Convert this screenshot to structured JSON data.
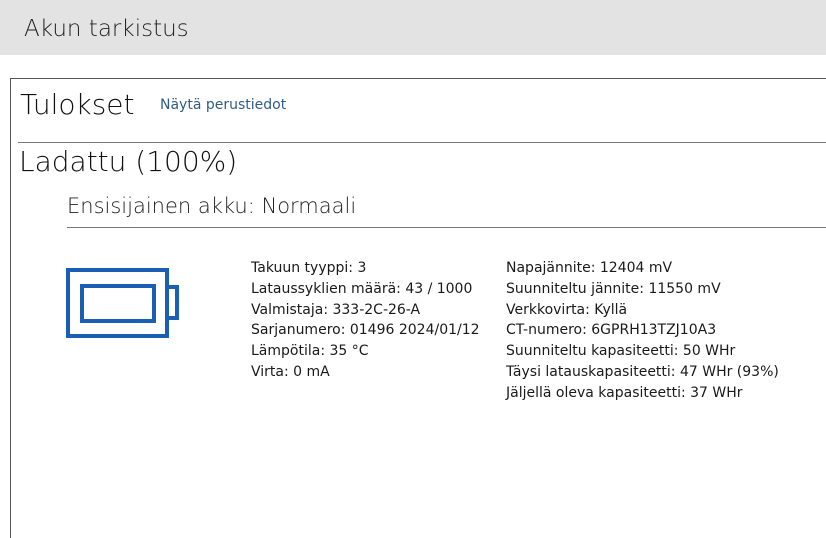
{
  "window": {
    "title": "Akun tarkistus"
  },
  "results": {
    "title": "Tulokset",
    "basic_info_link": "Näytä perustiedot"
  },
  "status": {
    "charge": "Ladattu (100%)"
  },
  "battery": {
    "heading": "Ensisijainen akku: Normaali",
    "icon": "battery-icon",
    "accent_color": "#1a5fb4",
    "left_details": [
      "Takuun tyyppi: 3",
      "Lataussyklien määrä: 43 / 1000",
      "Valmistaja: 333-2C-26-A",
      "Sarjanumero: 01496 2024/01/12",
      "Lämpötila: 35 °C",
      "Virta: 0 mA"
    ],
    "right_details": [
      "Napajännite: 12404 mV",
      "Suunniteltu jännite: 11550 mV",
      "Verkkovirta: Kyllä",
      "CT-numero: 6GPRH13TZJ10A3",
      "Suunniteltu kapasiteetti: 50 WHr",
      "Täysi latauskapasiteetti: 47 WHr (93%)",
      "Jäljellä oleva kapasiteetti: 37 WHr"
    ]
  }
}
